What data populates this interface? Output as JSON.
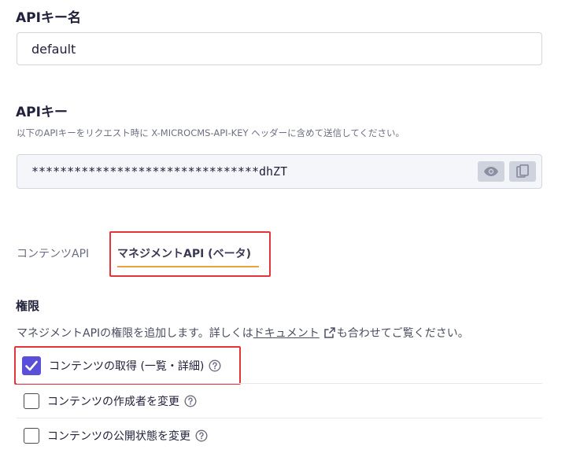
{
  "api_key_name": {
    "label": "APIキー名",
    "value": "default"
  },
  "api_key": {
    "label": "APIキー",
    "description": "以下のAPIキーをリクエスト時に X-MICROCMS-API-KEY ヘッダーに含めて送信してください。",
    "masked_value": "********************************dhZT",
    "show_icon": "eye-icon",
    "copy_icon": "copy-icon"
  },
  "tabs": [
    {
      "label": "コンテンツAPI",
      "active": false
    },
    {
      "label": "マネジメントAPI (ベータ)",
      "active": true
    }
  ],
  "permissions": {
    "title": "権限",
    "description_before": "マネジメントAPIの権限を追加します。詳しくは",
    "doc_link": "ドキュメント",
    "description_after": "も合わせてご覧ください。",
    "items": [
      {
        "label": "コンテンツの取得 (一覧・詳細)",
        "checked": true
      },
      {
        "label": "コンテンツの作成者を変更",
        "checked": false
      },
      {
        "label": "コンテンツの公開状態を変更",
        "checked": false
      }
    ]
  },
  "colors": {
    "accent": "#5a4fd8",
    "tab_underline": "#e8a33b",
    "highlight": "#e5353b"
  }
}
